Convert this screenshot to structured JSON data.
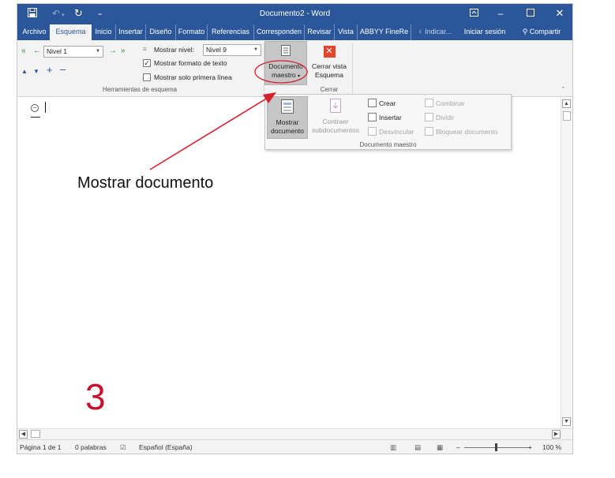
{
  "window": {
    "title": "Documento2 - Word",
    "qat": {
      "save_icon": "save-icon",
      "undo_icon": "undo-icon",
      "redo_icon": "redo-icon",
      "customize_icon": "customize-qat-icon"
    },
    "controls": {
      "ribbon_display_icon": "ribbon-display-icon",
      "minimize_icon": "minimize-icon",
      "maximize_icon": "maximize-icon",
      "close_icon": "close-icon"
    }
  },
  "tabs": [
    {
      "label": "Archivo",
      "active": false
    },
    {
      "label": "Esquema",
      "active": true
    },
    {
      "label": "Inicio",
      "active": false
    },
    {
      "label": "Insertar",
      "active": false
    },
    {
      "label": "Diseño",
      "active": false
    },
    {
      "label": "Formato",
      "active": false
    },
    {
      "label": "Referencias",
      "active": false
    },
    {
      "label": "Corresponden",
      "active": false
    },
    {
      "label": "Revisar",
      "active": false
    },
    {
      "label": "Vista",
      "active": false
    },
    {
      "label": "ABBYY FineRe",
      "active": false
    }
  ],
  "tell_me": "Indicar...",
  "signin": "Iniciar sesión",
  "share": "Compartir",
  "ribbon": {
    "outline_tools": {
      "group_label": "Herramientas de esquema",
      "level_value": "Nivel 1",
      "show_level_label": "Mostrar nivel:",
      "show_level_value": "Nivel 9",
      "show_text_formatting": "Mostrar formato de texto",
      "show_text_formatting_checked": true,
      "show_first_line_only": "Mostrar solo primera línea",
      "show_first_line_only_checked": false
    },
    "master_document": {
      "button_label_1": "Documento",
      "button_label_2": "maestro",
      "close_label_1": "Cerrar vista",
      "close_label_2": "Esquema",
      "close_group_label": "Cerrar"
    }
  },
  "dropdown": {
    "group_label": "Documento maestro",
    "show_document_1": "Mostrar",
    "show_document_2": "documento",
    "collapse_1": "Contraer",
    "collapse_2": "subdocumentos",
    "create": "Crear",
    "insert": "Insertar",
    "unlink": "Desvincular",
    "merge": "Combinar",
    "split": "Dividir",
    "lock": "Bloquear documento"
  },
  "statusbar": {
    "page": "Página 1 de 1",
    "words": "0 palabras",
    "language": "Español (España)",
    "zoom_minus": "–",
    "zoom_plus": "+",
    "zoom": "100 %"
  },
  "annotation": {
    "callout": "Mostrar documento",
    "step": "3",
    "color": "#c8102e"
  },
  "colors": {
    "accent": "#2b579a",
    "annotation": "#d6212d"
  }
}
